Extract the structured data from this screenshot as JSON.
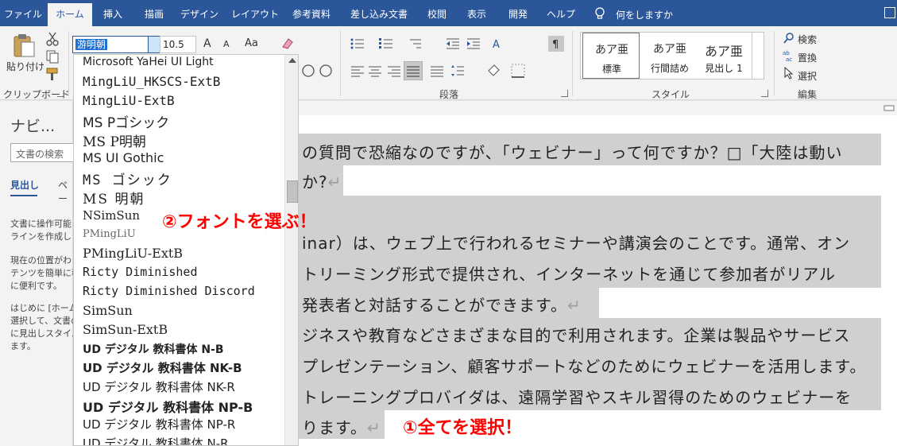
{
  "tabs": [
    "ファイル",
    "ホーム",
    "挿入",
    "描画",
    "デザイン",
    "レイアウト",
    "参考資料",
    "差し込み文書",
    "校閲",
    "表示",
    "開発",
    "ヘルプ"
  ],
  "tell_me": "何をしますか",
  "ribbon": {
    "paste": "貼り付け",
    "clipboard": "クリップボード",
    "font_name": "游明朝",
    "font_size": "10.5",
    "grow_font": "A",
    "shrink_font": "A",
    "change_case": "Aa",
    "paragraph": "段落",
    "styles": "スタイル",
    "style_items": [
      {
        "preview": "あア亜",
        "label": "標準"
      },
      {
        "preview": "あア亜",
        "label": "行間詰め"
      },
      {
        "preview": "あア亜",
        "label": "見出し 1"
      }
    ],
    "find": "検索",
    "replace": "置換",
    "select": "選択",
    "editing": "編集"
  },
  "nav": {
    "title": "ナビ...",
    "search_placeholder": "文書の検索",
    "tab_headings": "見出し",
    "tab_pages": "ペー",
    "help_lines": [
      "文書に操作可能",
      "ラインを作成し",
      "現在の位置がわ",
      "テンツを簡単に移",
      "に便利です。",
      "はじめに [ホーム",
      "選択して、文書の",
      "に見出しスタイル",
      "ます。"
    ]
  },
  "font_list": [
    "Microsoft YaHei UI Light",
    "MingLiU_HKSCS-ExtB",
    "MingLiU-ExtB",
    "MS Pゴシック",
    "MS P明朝",
    "MS UI Gothic",
    "MS ゴシック",
    "MS 明朝",
    "NSimSun",
    "PMingLiU",
    "PMingLiU-ExtB",
    "Ricty Diminished",
    "Ricty Diminished Discord",
    "SimSun",
    "SimSun-ExtB",
    "UD デジタル 教科書体 N-B",
    "UD デジタル 教科書体 NK-B",
    "UD デジタル 教科書体 NK-R",
    "UD デジタル 教科書体 NP-B",
    "UD デジタル 教科書体 NP-R",
    "UD デジタル 教科書体 N-R"
  ],
  "document_lines": [
    "の質問で恐縮なのですが、「ウェビナー」って何ですか？□「大陸は動い",
    "か?",
    "inar）は、ウェブ上で行われるセミナーや講演会のことです。通常、オン",
    "トリーミング形式で提供され、インターネットを通じて参加者がリアル",
    "発表者と対話することができます。",
    "ジネスや教育などさまざまな目的で利用されます。企業は製品やサービス",
    "プレゼンテーション、顧客サポートなどのためにウェビナーを活用します。",
    "トレーニングプロバイダは、遠隔学習やスキル習得のためのウェビナーを",
    "ります。"
  ],
  "para_mark": "↵",
  "annotations": {
    "choose_font": "②フォントを選ぶ！",
    "select_all": "①全てを選択！"
  },
  "colors": {
    "accent": "#2b579a",
    "annotation": "#ff0000",
    "highlight": "#d0d0d0"
  }
}
